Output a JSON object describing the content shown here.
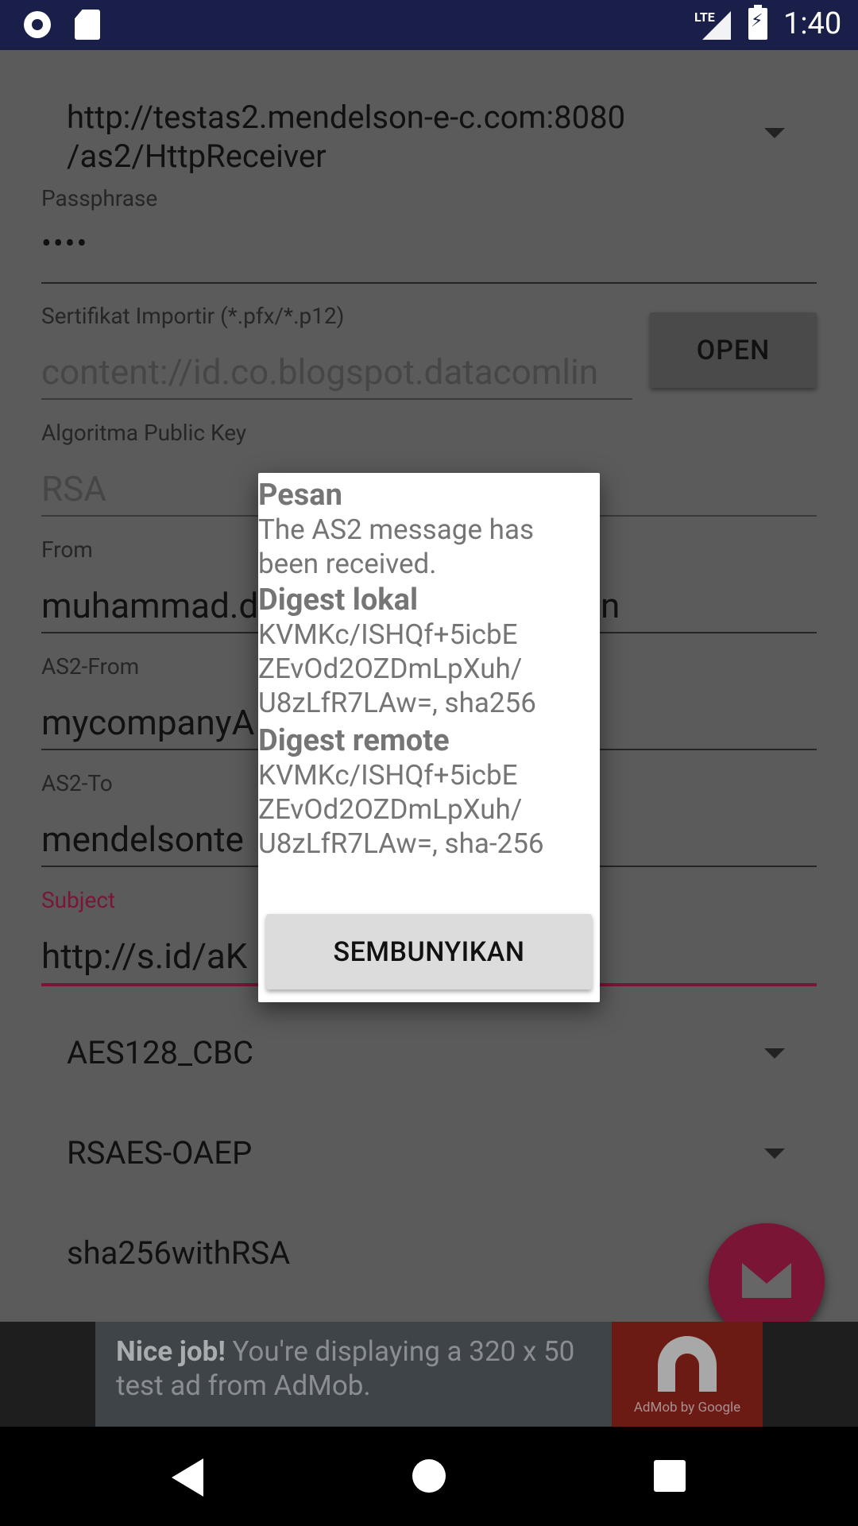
{
  "status_bar": {
    "network": "LTE",
    "time": "1:40"
  },
  "form": {
    "url_spinner": {
      "line1": "http://testas2.mendelson-e-c.com:8080",
      "line2": "/as2/HttpReceiver"
    },
    "passphrase": {
      "label": "Passphrase",
      "value": "••••"
    },
    "certificate": {
      "label": "Sertifikat Importir (*.pfx/*.p12)",
      "value": "content://id.co.blogspot.datacomlin",
      "button": "OPEN"
    },
    "public_key": {
      "label": "Algoritma Public Key",
      "value": "RSA"
    },
    "from": {
      "label": "From",
      "value_left": "muhammad.d",
      "value_right": "n"
    },
    "as2_from": {
      "label": "AS2-From",
      "value": "mycompanyA"
    },
    "as2_to": {
      "label": "AS2-To",
      "value": "mendelsonte"
    },
    "subject": {
      "label": "Subject",
      "value": "http://s.id/aK"
    },
    "encryption": "AES128_CBC",
    "key_wrap": "RSAES-OAEP",
    "signature": "sha256withRSA"
  },
  "dialog": {
    "title": "Pesan",
    "message": "The AS2 message has been received.",
    "local_digest_heading": "Digest lokal",
    "local_digest_line1": "KVMKc/ISHQf+5icbE",
    "local_digest_line2": "ZEvOd2OZDmLpXuh/",
    "local_digest_line3": "U8zLfR7LAw=, sha256",
    "remote_digest_heading": "Digest remote",
    "remote_digest_line1": "KVMKc/ISHQf+5icbE",
    "remote_digest_line2": "ZEvOd2OZDmLpXuh/",
    "remote_digest_line3": "U8zLfR7LAw=, sha-256",
    "button": "SEMBUNYIKAN"
  },
  "ad": {
    "bold": "Nice job!",
    "text": " You're displaying a 320 x 50 test ad from AdMob.",
    "logo_text": "AdMob by Google"
  },
  "colors": {
    "accent": "#e91e63",
    "status_bar": "#1a1f4a",
    "scrim": "#5b5b5b"
  }
}
